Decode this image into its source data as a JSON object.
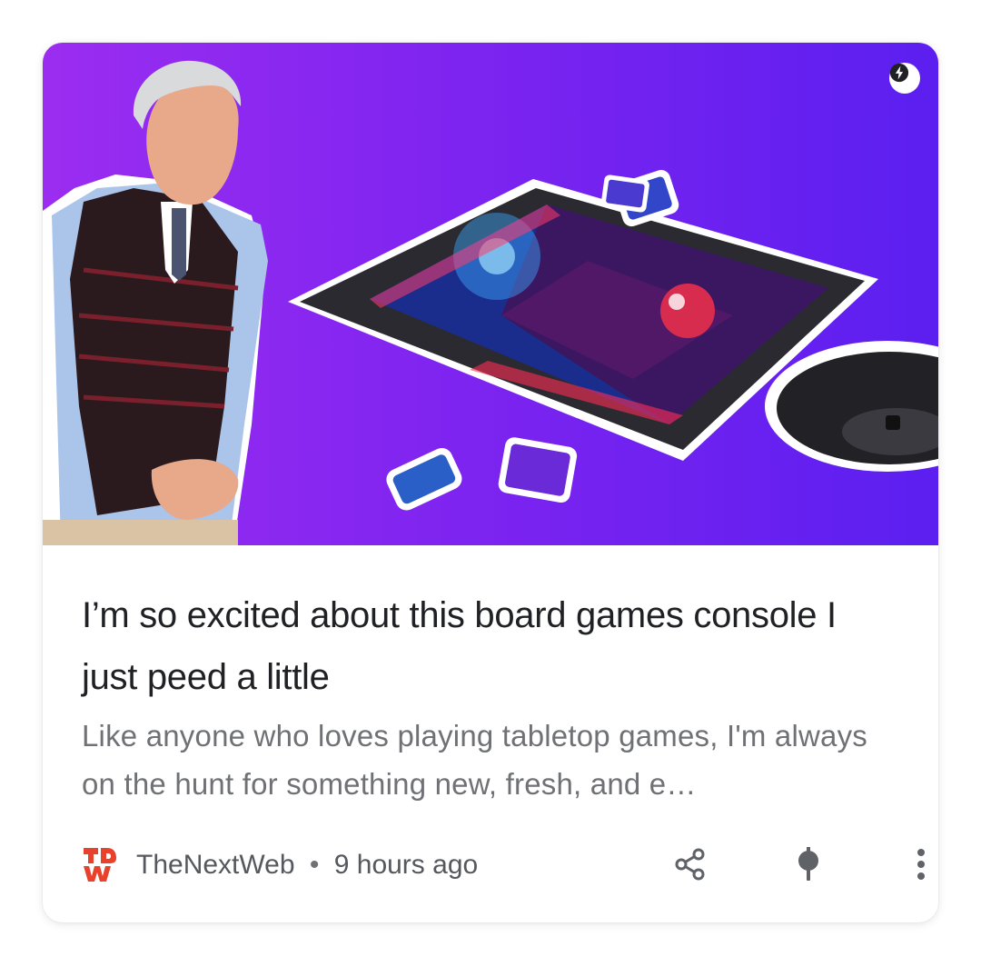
{
  "article": {
    "headline": "I’m so excited about this board games console I just peed a little",
    "snippet": "Like anyone who loves playing tabletop games, I'm always on the hunt for something new, fresh, and e…",
    "source": "TheNextWeb",
    "separator": "•",
    "time": "9 hours ago",
    "logo_text": "TNW"
  },
  "hero": {
    "description_icon": "amp-lightning-icon",
    "background_colors": [
      "#9b2df0",
      "#5b1ff0"
    ]
  },
  "actions": {
    "icons": [
      "share-icon",
      "pin-icon",
      "more-vert-icon"
    ]
  },
  "colors": {
    "headline": "#202124",
    "snippet": "#6f7175",
    "source_logo": "#e8412c"
  }
}
